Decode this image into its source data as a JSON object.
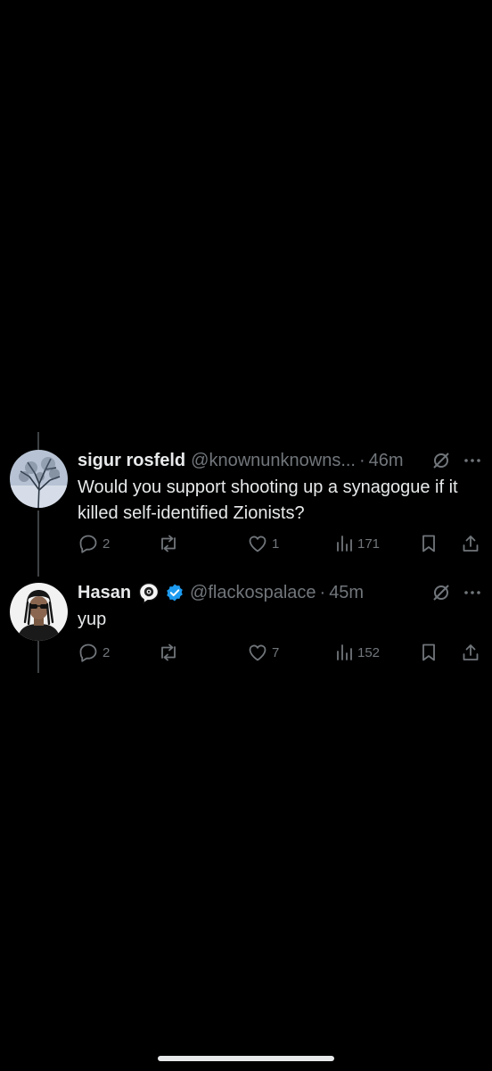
{
  "tweets": [
    {
      "name": "sigur rosfeld",
      "handle": "@knownunknowns...",
      "dot": "·",
      "time": "46m",
      "text": "Would you support shooting up a synagogue if it killed self-identified Zionists?",
      "replies": "2",
      "likes": "1",
      "views": "171",
      "avatar_icon": "winter-tree-avatar"
    },
    {
      "name": "Hasan",
      "emoji": "eye-in-speech-bubble",
      "verified": true,
      "handle": "@flackospalace",
      "dot": "·",
      "time": "45m",
      "text": "yup",
      "replies": "2",
      "likes": "7",
      "views": "152",
      "avatar_icon": "portrait-avatar"
    }
  ],
  "colors": {
    "background": "#000000",
    "text_primary": "#e7e9ea",
    "text_secondary": "#71767b",
    "verified_blue": "#1d9bf0"
  }
}
